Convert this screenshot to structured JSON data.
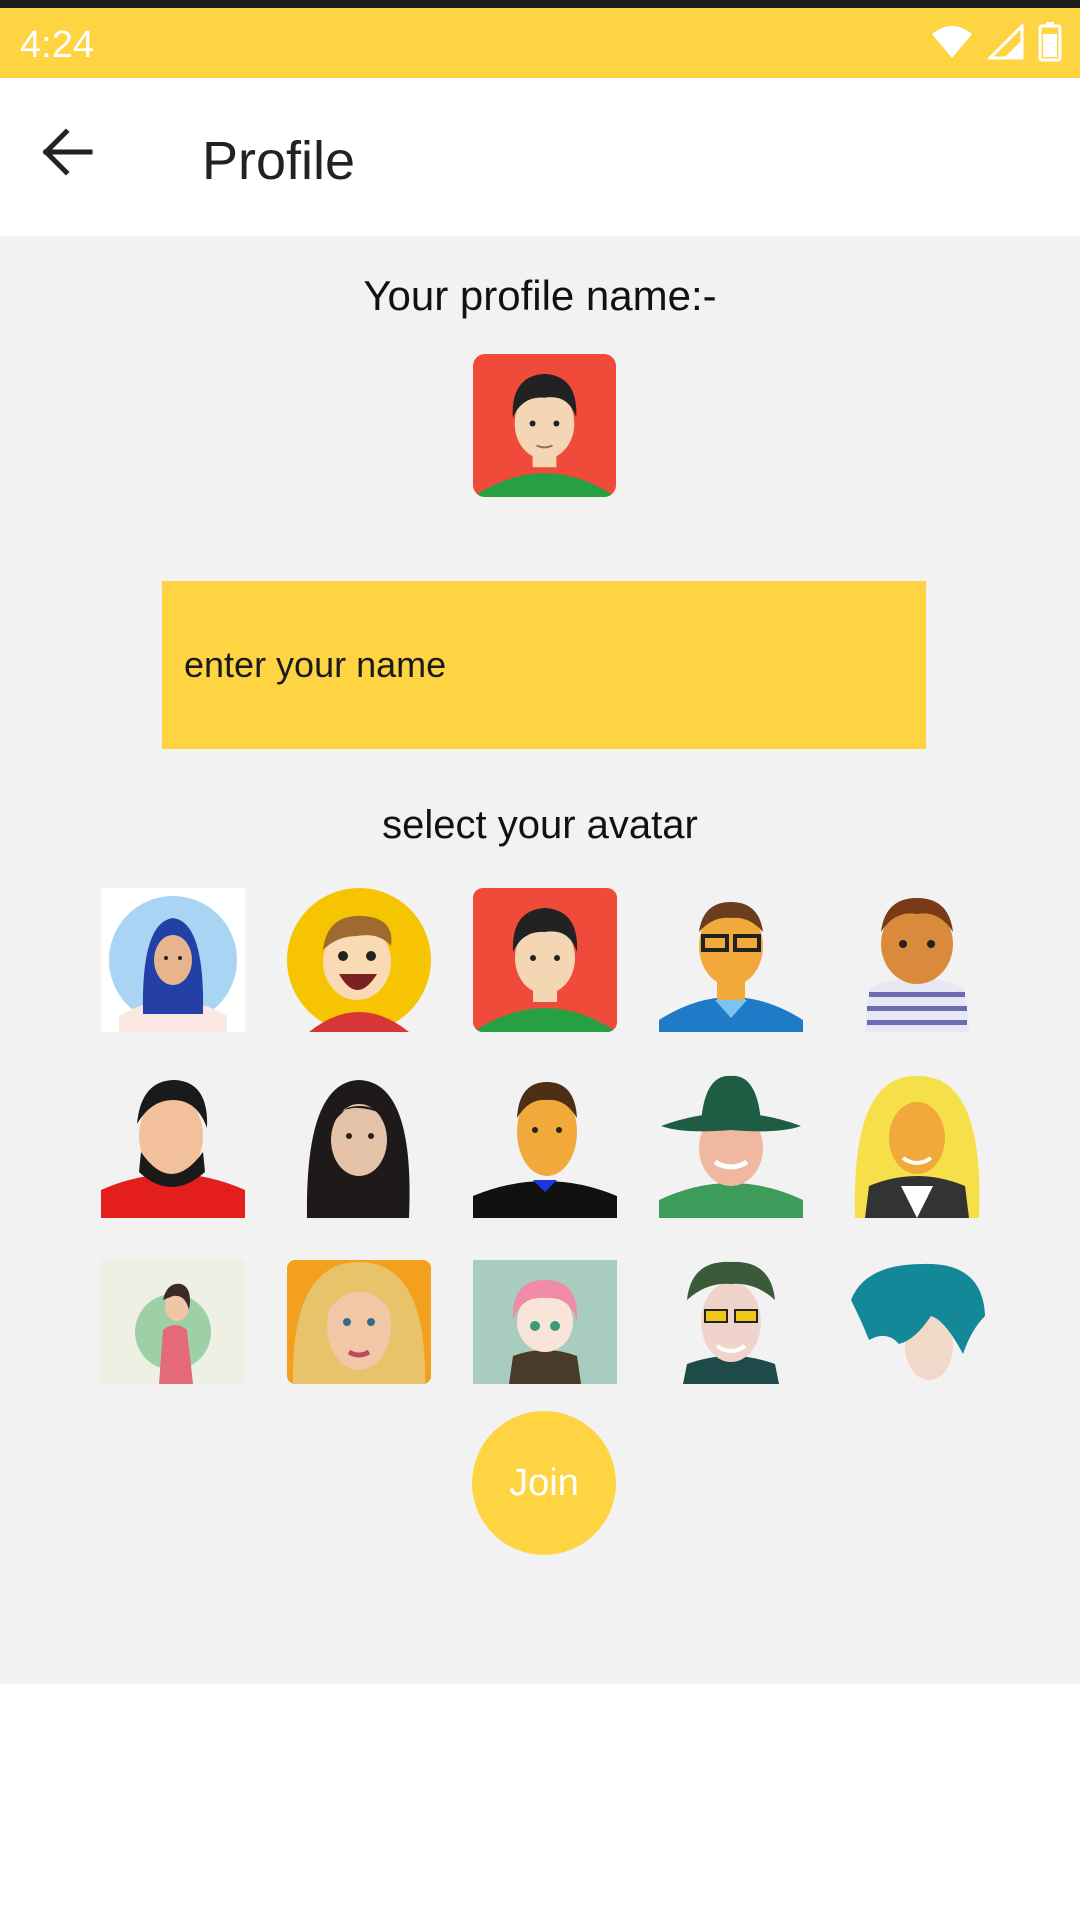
{
  "status_bar": {
    "time": "4:24",
    "icons": [
      "wifi-icon",
      "signal-icon",
      "battery-icon"
    ]
  },
  "app_bar": {
    "title": "Profile",
    "back_icon": "arrow-left-icon"
  },
  "profile": {
    "label": "Your profile name:-",
    "selected_avatar": "avatar-3"
  },
  "name_input": {
    "placeholder": "enter your name",
    "value": ""
  },
  "avatar_section": {
    "label": "select your avatar"
  },
  "avatars": [
    "avatar-1",
    "avatar-2",
    "avatar-3",
    "avatar-4",
    "avatar-5",
    "avatar-6",
    "avatar-7",
    "avatar-8",
    "avatar-9",
    "avatar-10",
    "avatar-11",
    "avatar-12",
    "avatar-13",
    "avatar-14",
    "avatar-15"
  ],
  "join_button": {
    "label": "Join"
  },
  "colors": {
    "accent": "#FED442",
    "background": "#F2F2F3",
    "app_bar": "#FFFFFF"
  }
}
